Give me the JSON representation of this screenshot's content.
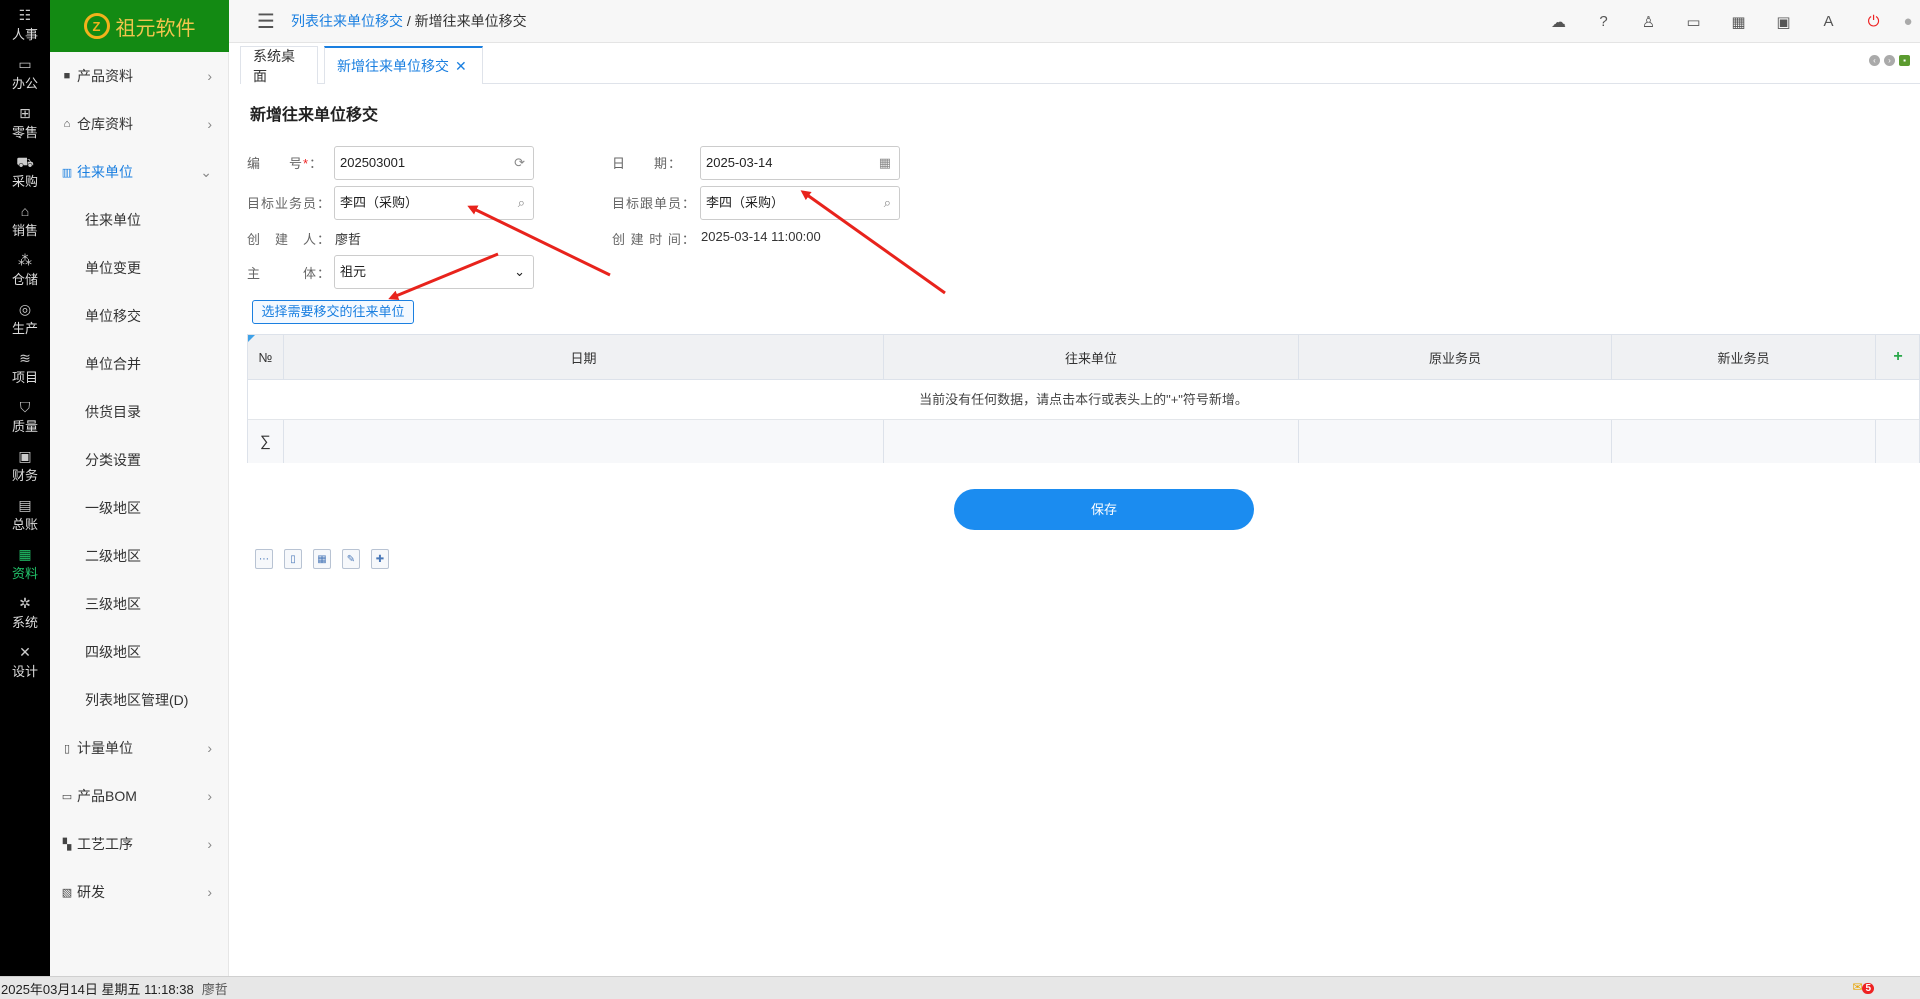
{
  "leftnav": [
    {
      "icon": "people-icon",
      "glyph": "☷",
      "label": "人事"
    },
    {
      "icon": "monitor-icon",
      "glyph": "▭",
      "label": "办公"
    },
    {
      "icon": "store-icon",
      "glyph": "⊞",
      "label": "零售"
    },
    {
      "icon": "truck-icon",
      "glyph": "⛟",
      "label": "采购"
    },
    {
      "icon": "shop-icon",
      "glyph": "⌂",
      "label": "销售"
    },
    {
      "icon": "warehouse-icon",
      "glyph": "⁂",
      "label": "仓储"
    },
    {
      "icon": "fingerprint-icon",
      "glyph": "◎",
      "label": "生产"
    },
    {
      "icon": "layers-icon",
      "glyph": "≋",
      "label": "项目"
    },
    {
      "icon": "shield-icon",
      "glyph": "⛉",
      "label": "质量"
    },
    {
      "icon": "finance-icon",
      "glyph": "▣",
      "label": "财务"
    },
    {
      "icon": "ledger-icon",
      "glyph": "▤",
      "label": "总账"
    },
    {
      "icon": "data-icon",
      "glyph": "▦",
      "label": "资料"
    },
    {
      "icon": "gear-icon",
      "glyph": "✲",
      "label": "系统"
    },
    {
      "icon": "tools-icon",
      "glyph": "✕",
      "label": "设计"
    }
  ],
  "logo": {
    "icon_text": "Z",
    "text": "祖元软件"
  },
  "sidebar": {
    "groups_top": [
      {
        "icon": "folder-icon",
        "glyph": "■",
        "label": "产品资料"
      },
      {
        "icon": "home-icon",
        "glyph": "⌂",
        "label": "仓库资料"
      }
    ],
    "open_group": {
      "icon": "building-icon",
      "glyph": "▥",
      "label": "往来单位"
    },
    "sub_items": [
      "往来单位",
      "单位变更",
      "单位移交",
      "单位合并",
      "供货目录",
      "分类设置",
      "一级地区",
      "二级地区",
      "三级地区",
      "四级地区",
      "列表地区管理(D)"
    ],
    "groups_bottom": [
      {
        "icon": "unit-icon",
        "glyph": "▯",
        "label": "计量单位"
      },
      {
        "icon": "bom-icon",
        "glyph": "▭",
        "label": "产品BOM"
      },
      {
        "icon": "process-icon",
        "glyph": "▚",
        "label": "工艺工序"
      },
      {
        "icon": "rd-icon",
        "glyph": "▧",
        "label": "研发"
      }
    ]
  },
  "topbar": {
    "breadcrumb_link": "列表往来单位移交",
    "breadcrumb_sep": " / ",
    "breadcrumb_current": "新增往来单位移交",
    "icons": [
      {
        "name": "cloud-icon",
        "glyph": "☁"
      },
      {
        "name": "help-icon",
        "glyph": "?"
      },
      {
        "name": "shirt-icon",
        "glyph": "♙"
      },
      {
        "name": "screen-icon",
        "glyph": "▭"
      },
      {
        "name": "grid-icon",
        "glyph": "▦"
      },
      {
        "name": "calendar-icon",
        "glyph": "▣"
      },
      {
        "name": "font-icon",
        "glyph": "A"
      },
      {
        "name": "power-icon",
        "glyph": "⏻"
      }
    ]
  },
  "tabs": {
    "desk": "系统桌面",
    "active": "新增往来单位移交",
    "close": "✕"
  },
  "form": {
    "title": "新增往来单位移交",
    "code_label": "编　　号",
    "code_required": "*",
    "code_colon": "：",
    "code_value": "202503001",
    "date_label": "日　　期：",
    "date_value": "2025-03-14",
    "target_salesman_label": "目标业务员：",
    "target_salesman_value": "李四（采购）",
    "target_follower_label": "目标跟单员：",
    "target_follower_value": "李四（采购）",
    "creator_label": "创　建　人：",
    "creator_value": "廖哲",
    "create_time_label": "创 建 时 间：",
    "create_time_value": "2025-03-14 11:00:00",
    "entity_label": "主　　　体：",
    "entity_value": "祖元",
    "select_button": "选择需要移交的往来单位"
  },
  "grid": {
    "headers": [
      "№",
      "日期",
      "往来单位",
      "原业务员",
      "新业务员"
    ],
    "add_glyph": "+",
    "empty_text": "当前没有任何数据，请点击本行或表头上的\"+\"符号新增。",
    "sum_symbol": "∑"
  },
  "save_button": "保存",
  "status": {
    "datetime": "2025年03月14日 星期五 11:18:38",
    "user": "廖哲",
    "msg_count": "5"
  },
  "colors": {
    "accent": "#1a7fe0",
    "logo_bg": "#138a13",
    "leftnav_bg": "#000000",
    "arrow": "#e8231c",
    "save_bg": "#1b8cf0"
  }
}
